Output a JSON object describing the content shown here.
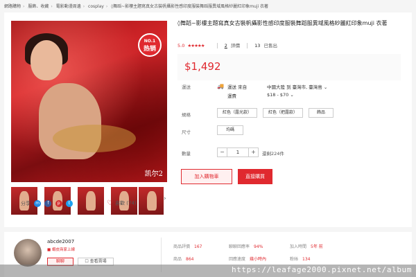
{
  "breadcrumb": [
    "網路購物",
    "服飾、收藏",
    "電影動漫周邊",
    "cosplay",
    "◊舞蹈~影樓主題寫真女古裝帆攝影性感印度服裝舞蹈服異域風格紗麗紅印象muji 衣著"
  ],
  "product": {
    "title": "◊舞蹈~影樓主題寫真女古裝帆攝影性感印度服裝舞蹈服異域風格紗麗紅印象muji 衣著",
    "rating": "5.0",
    "stars": "★★★★★",
    "reviews_count": "2",
    "reviews_label": "評價",
    "sold_count": "13",
    "sold_label": "已售出",
    "price": "$1,492",
    "badge_no": "NO.1",
    "badge_hot": "热销",
    "watermark": "凯尔2"
  },
  "shipping": {
    "label": "運送",
    "from_label": "運送 來自",
    "fee_label": "運費",
    "from_value": "中國大陸 到 臺灣市, 臺灣島 ⌄",
    "fee_value": "$18 - $70 ⌄"
  },
  "options": {
    "spec_label": "規格",
    "spec_values": [
      "紅色（露光款）",
      "紅色（把露款）",
      "飾品"
    ],
    "size_label": "尺寸",
    "size_values": [
      "均碼"
    ]
  },
  "quantity": {
    "label": "數量",
    "minus": "−",
    "value": "1",
    "plus": "+",
    "stock": "還剩224件"
  },
  "actions": {
    "add_to_cart": "加入購物車",
    "buy_now": "直接購買"
  },
  "social": {
    "share_label": "分享",
    "fav_count": "喜歡 (74)",
    "icons": [
      "messenger-icon",
      "facebook-icon",
      "pinterest-icon",
      "twitter-icon"
    ]
  },
  "seller": {
    "name": "abcde2007",
    "tag": "■ 蝦皮商家上線",
    "chat": "聊聊",
    "shop": "☐ 查看賣場",
    "metrics": [
      {
        "label": "商品評價",
        "value": "167"
      },
      {
        "label": "聊聊回應率",
        "value": "94%"
      },
      {
        "label": "加入時間",
        "value": "5年 前"
      },
      {
        "label": "商品",
        "value": "864"
      },
      {
        "label": "回應速度",
        "value": "幾小時內"
      },
      {
        "label": "粉絲",
        "value": "134"
      }
    ]
  },
  "footer": {
    "url": "https://leafage2000.pixnet.net/album"
  },
  "colors": {
    "accent": "#e0292f",
    "background": "#f5f5f5"
  }
}
